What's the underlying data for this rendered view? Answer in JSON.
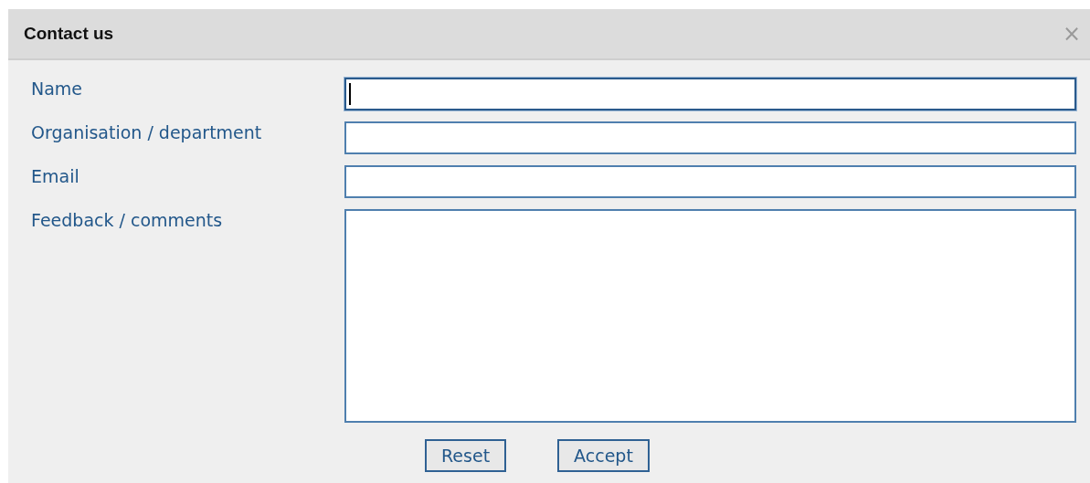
{
  "dialog": {
    "title": "Contact us",
    "close": "×"
  },
  "fields": [
    {
      "label": "Name",
      "kind": "text",
      "focused": true
    },
    {
      "label": "Organisation / department",
      "kind": "text",
      "focused": false
    },
    {
      "label": "Email",
      "kind": "text",
      "focused": false
    },
    {
      "label": "Feedback / comments",
      "kind": "textarea",
      "focused": false
    }
  ],
  "buttons": [
    "Reset",
    "Accept"
  ]
}
